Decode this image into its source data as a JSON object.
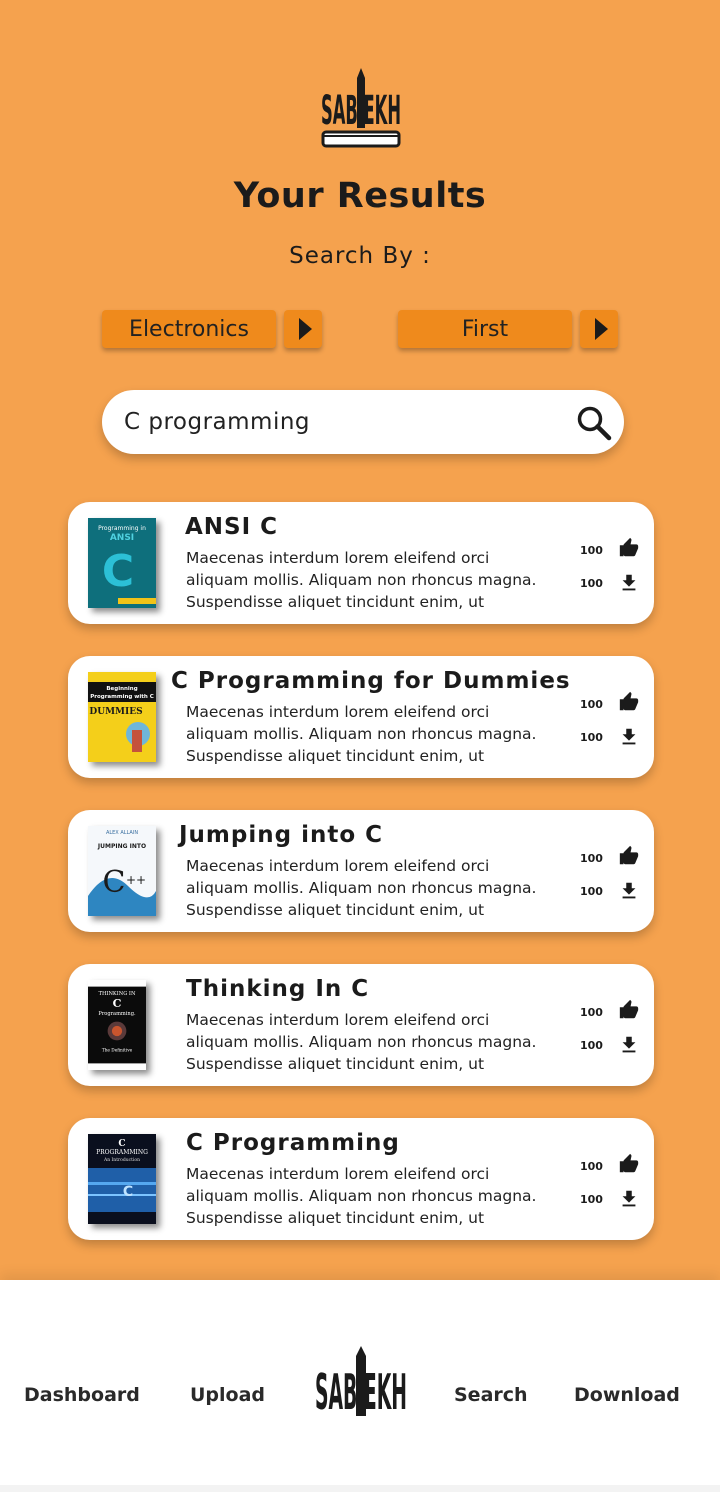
{
  "brand": {
    "logo_text": "SABEEKH"
  },
  "header": {
    "title": "Your Results",
    "subtitle": "Search By :"
  },
  "filters": [
    {
      "label": "Electronics"
    },
    {
      "label": "First"
    }
  ],
  "search": {
    "value": "C programming",
    "placeholder": ""
  },
  "results": [
    {
      "title": "ANSI C",
      "description": "Maecenas interdum lorem eleifend orci aliquam mollis. Aliquam non rhoncus magna. Suspendisse aliquet tincidunt enim, ut",
      "likes": "100",
      "downloads": "100",
      "cover_text": "Programming in ANSI C"
    },
    {
      "title": "C Programming for Dummies",
      "description": "Maecenas interdum lorem eleifend orci aliquam mollis. Aliquam non rhoncus magna. Suspendisse aliquet tincidunt enim, ut",
      "likes": "100",
      "downloads": "100",
      "cover_text": "Beginning Programming with C For Dummies"
    },
    {
      "title": "Jumping into C",
      "description": "Maecenas interdum lorem eleifend orci aliquam mollis. Aliquam non rhoncus magna. Suspendisse aliquet tincidunt enim, ut",
      "likes": "100",
      "downloads": "100",
      "cover_text": "JUMPING INTO C++"
    },
    {
      "title": "Thinking In C",
      "description": "Maecenas interdum lorem eleifend orci aliquam mollis. Aliquam non rhoncus magna. Suspendisse aliquet tincidunt enim, ut",
      "likes": "100",
      "downloads": "100",
      "cover_text": "Thinking In C Programming"
    },
    {
      "title": "C Programming",
      "description": "Maecenas interdum lorem eleifend orci aliquam mollis. Aliquam non rhoncus magna. Suspendisse aliquet tincidunt enim, ut",
      "likes": "100",
      "downloads": "100",
      "cover_text": "C PROGRAMMING An Introduction"
    }
  ],
  "nav": {
    "dashboard": "Dashboard",
    "upload": "Upload",
    "search": "Search",
    "download": "Download"
  },
  "colors": {
    "background": "#f5a24e",
    "button": "#ef8a1c",
    "text": "#1b1b1b",
    "card": "#ffffff"
  },
  "icons": {
    "like": "thumbs-up-icon",
    "download": "download-icon",
    "search": "search-icon",
    "filter_arrow": "play-arrow-icon"
  }
}
